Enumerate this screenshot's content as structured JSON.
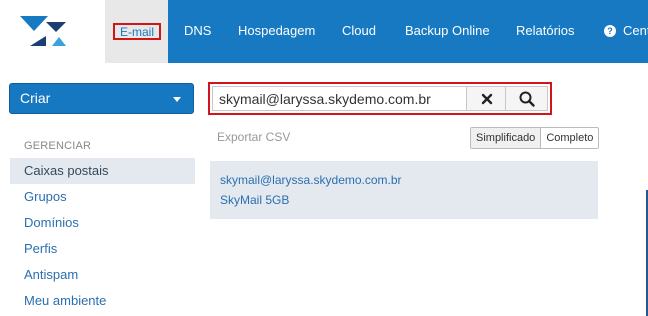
{
  "nav": {
    "items": {
      "email": "E-mail",
      "dns": "DNS",
      "hospedagem": "Hospedagem",
      "cloud": "Cloud",
      "backup": "Backup Online",
      "relatorios": "Relatórios",
      "central": "Cent"
    },
    "help_glyph": "?"
  },
  "sidebar": {
    "create_button": "Criar",
    "section_heading": "GERENCIAR",
    "items": [
      "Caixas postais",
      "Grupos",
      "Domínios",
      "Perfis",
      "Antispam",
      "Meu ambiente"
    ],
    "active_index": 0
  },
  "search": {
    "value": "skymail@laryssa.skydemo.com.br"
  },
  "toolbar": {
    "export_label": "Exportar CSV",
    "simplified_label": "Simplificado",
    "complete_label": "Completo"
  },
  "result": {
    "email": "skymail@laryssa.skydemo.com.br",
    "plan": "SkyMail 5GB"
  },
  "colors": {
    "brand_blue": "#1779c2",
    "highlight_red": "#d0161b",
    "link_blue": "#2a6fb0",
    "panel_bg": "#e3e9ef"
  }
}
